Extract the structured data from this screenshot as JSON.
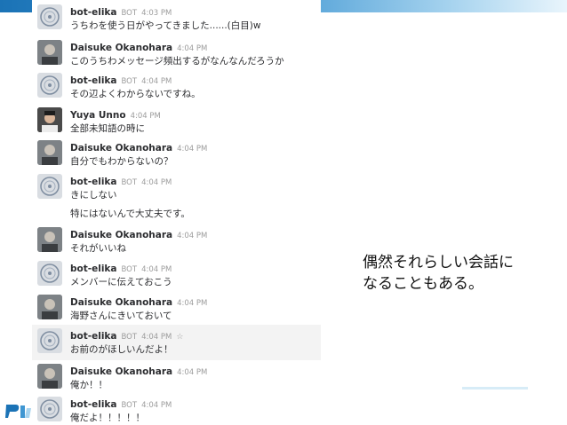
{
  "colors": {
    "name": "#2c2d30",
    "muted": "#9b9b9b",
    "accent": "#1b73b6"
  },
  "messages": [
    {
      "name": "bot-elika",
      "bot": "BOT",
      "time": "4:03 PM",
      "avatar": "bot-avatar-icon",
      "lines": [
        "うちわを使う日がやってきました......(白目)w"
      ]
    },
    {
      "name": "Daisuke Okanohara",
      "time": "4:04 PM",
      "avatar": "user-avatar-daisuke",
      "lines": [
        "このうちわメッセージ頻出するがなんなんだろうか"
      ]
    },
    {
      "name": "bot-elika",
      "bot": "BOT",
      "time": "4:04 PM",
      "avatar": "bot-avatar-icon",
      "lines": [
        "その辺よくわからないですね。"
      ]
    },
    {
      "name": "Yuya Unno",
      "time": "4:04 PM",
      "avatar": "user-avatar-yuya",
      "lines": [
        "全部未知語の時に"
      ]
    },
    {
      "name": "Daisuke Okanohara",
      "time": "4:04 PM",
      "avatar": "user-avatar-daisuke",
      "lines": [
        "自分でもわからないの？"
      ]
    },
    {
      "name": "bot-elika",
      "bot": "BOT",
      "time": "4:04 PM",
      "avatar": "bot-avatar-icon",
      "lines": [
        "きにしない",
        "特にはないんで大丈夫です。"
      ]
    },
    {
      "name": "Daisuke Okanohara",
      "time": "4:04 PM",
      "avatar": "user-avatar-daisuke",
      "lines": [
        "それがいいね"
      ]
    },
    {
      "name": "bot-elika",
      "bot": "BOT",
      "time": "4:04 PM",
      "avatar": "bot-avatar-icon",
      "lines": [
        "メンバーに伝えておこう"
      ]
    },
    {
      "name": "Daisuke Okanohara",
      "time": "4:04 PM",
      "avatar": "user-avatar-daisuke",
      "lines": [
        "海野さんにきいておいて"
      ]
    },
    {
      "name": "bot-elika",
      "bot": "BOT",
      "time": "4:04 PM",
      "star": "☆",
      "avatar": "bot-avatar-icon",
      "lines": [
        "お前のがほしいんだよ！"
      ]
    },
    {
      "name": "Daisuke Okanohara",
      "time": "4:04 PM",
      "avatar": "user-avatar-daisuke",
      "lines": [
        "俺か！！"
      ]
    },
    {
      "name": "bot-elika",
      "bot": "BOT",
      "time": "4:04 PM",
      "avatar": "bot-avatar-icon",
      "lines": [
        "俺だよ！！！！！"
      ]
    }
  ],
  "caption": {
    "line1": "偶然それらしい会話に",
    "line2": "なることもある。"
  }
}
